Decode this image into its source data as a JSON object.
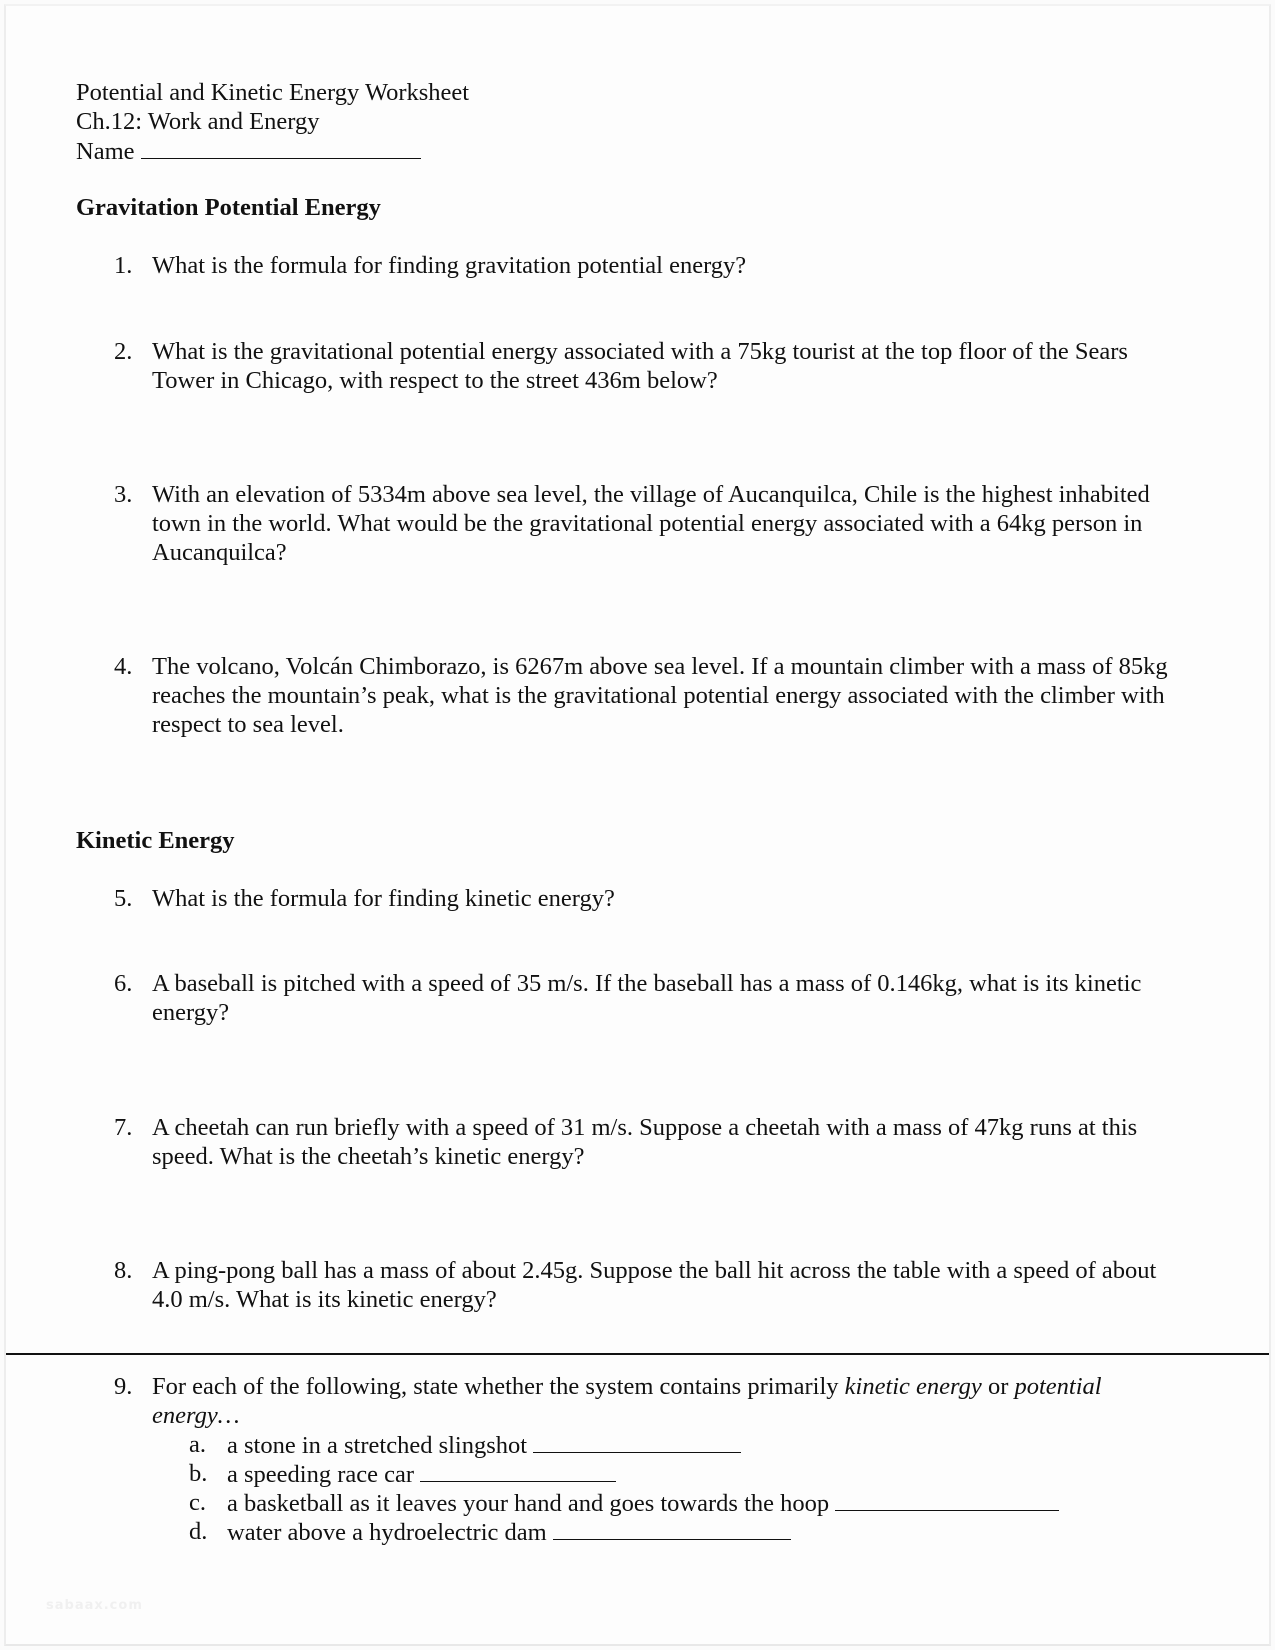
{
  "header": {
    "title": "Potential and Kinetic Energy Worksheet",
    "chapter": "Ch.12: Work and Energy",
    "name_label": "Name"
  },
  "sections": [
    {
      "heading": "Gravitation Potential Energy",
      "questions": [
        {
          "number": "1.",
          "lines": [
            "What is the formula for finding gravitation potential energy?"
          ]
        },
        {
          "number": "2.",
          "lines": [
            "What is the gravitational potential energy associated with a 75kg tourist at the top floor of the Sears",
            "Tower in Chicago, with respect to the street 436m below?"
          ]
        },
        {
          "number": "3.",
          "lines": [
            "With an elevation of 5334m above sea level, the village of Aucanquilca, Chile is the highest inhabited",
            "town in the world.  What would be the gravitational potential energy associated with a 64kg person in",
            "Aucanquilca?"
          ]
        },
        {
          "number": "4.",
          "lines": [
            "The volcano, Volcán Chimborazo, is 6267m above sea level.  If a mountain climber with a mass of 85kg",
            "reaches the mountain’s peak, what is the gravitational potential energy associated with the climber with",
            "respect to sea level."
          ]
        }
      ]
    },
    {
      "heading": "Kinetic Energy",
      "questions": [
        {
          "number": "5.",
          "lines": [
            "What is the formula for finding kinetic energy?"
          ]
        },
        {
          "number": "6.",
          "lines": [
            "A baseball is pitched with a speed of 35 m/s.  If the baseball has a mass of 0.146kg, what is its kinetic",
            "energy?"
          ]
        },
        {
          "number": "7.",
          "lines": [
            "A cheetah can run briefly with a speed of 31 m/s.  Suppose a cheetah with a mass of 47kg runs at this",
            "speed.  What is the cheetah’s kinetic energy?"
          ]
        },
        {
          "number": "8.",
          "lines": [
            "A ping-pong ball has a mass of about 2.45g.  Suppose the ball hit across the table with a speed of about",
            "4.0 m/s.  What is its kinetic energy?"
          ]
        }
      ]
    }
  ],
  "question9": {
    "number": "9.",
    "prefix": "For each of the following, state whether the system contains primarily ",
    "term1": "kinetic energy",
    "middle": " or ",
    "term2": "potential",
    "line2": "energy…",
    "items": [
      {
        "letter": "a.",
        "text": "a stone in a stretched slingshot"
      },
      {
        "letter": "b.",
        "text": "a speeding race car"
      },
      {
        "letter": "c.",
        "text": "a basketball as it leaves your hand and goes towards the hoop"
      },
      {
        "letter": "d.",
        "text": "water above a hydroelectric dam"
      }
    ]
  },
  "watermark": "sabaax.com"
}
